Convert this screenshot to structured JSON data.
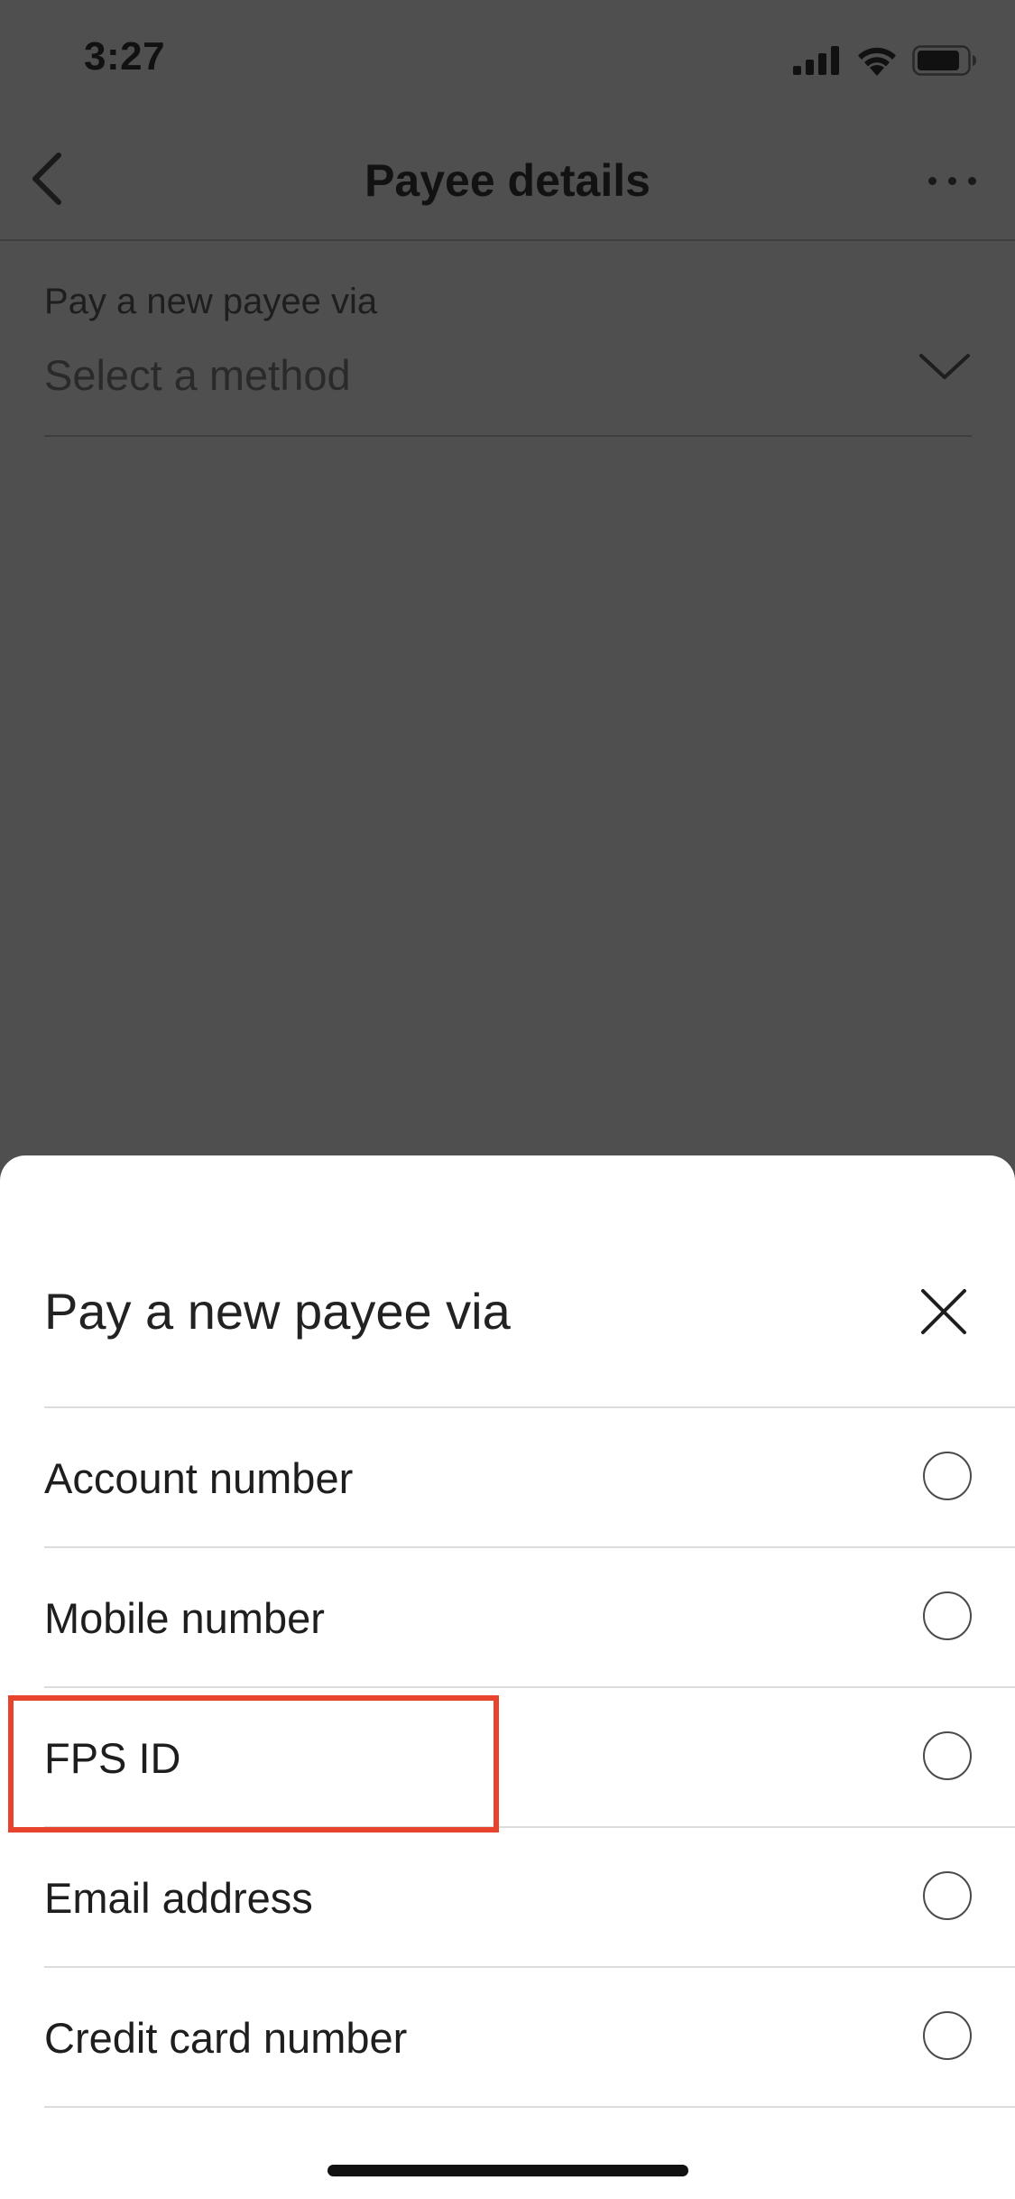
{
  "status_bar": {
    "time": "3:27",
    "icons": [
      "cellular-signal-icon",
      "wifi-icon",
      "battery-icon"
    ]
  },
  "nav": {
    "back_icon": "chevron-left-icon",
    "title": "Payee details",
    "more_icon": "more-horizontal-icon"
  },
  "method_field": {
    "label": "Pay a new payee via",
    "placeholder": "Select a method",
    "icon": "chevron-down-icon"
  },
  "sheet": {
    "title": "Pay a new payee via",
    "close_icon": "close-icon",
    "options": [
      {
        "label": "Account number",
        "selected": false
      },
      {
        "label": "Mobile number",
        "selected": false
      },
      {
        "label": "FPS ID",
        "selected": false
      },
      {
        "label": "Email address",
        "selected": false
      },
      {
        "label": "Credit card number",
        "selected": false
      }
    ]
  },
  "colors": {
    "overlay": "#4f4f4f",
    "sheet_background": "#ffffff",
    "highlight_box": "#e8432c"
  }
}
